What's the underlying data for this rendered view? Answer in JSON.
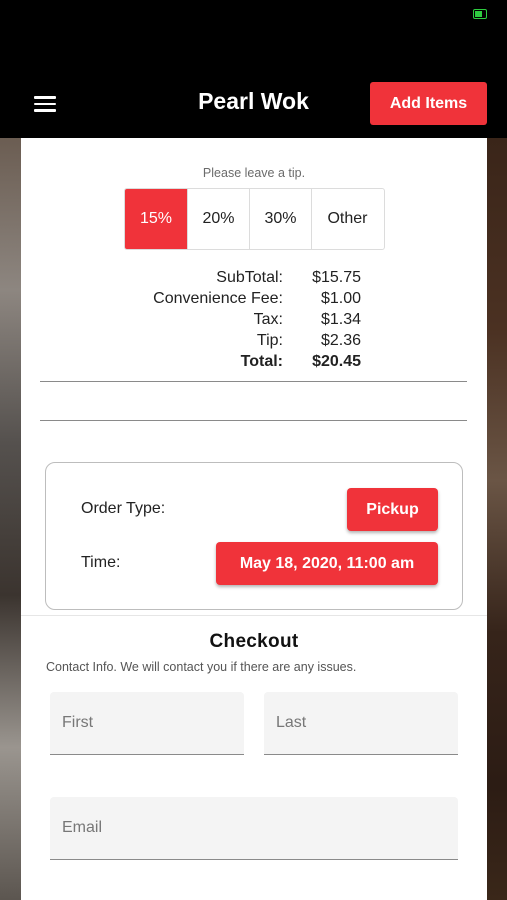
{
  "app": {
    "title": "Pearl Wok",
    "add_items_label": "Add Items"
  },
  "tip": {
    "prompt": "Please leave a tip.",
    "options": [
      "15%",
      "20%",
      "30%",
      "Other"
    ],
    "selected": "15%"
  },
  "summary": {
    "rows": [
      {
        "label": "SubTotal:",
        "value": "$15.75"
      },
      {
        "label": "Convenience Fee:",
        "value": "$1.00"
      },
      {
        "label": "Tax:",
        "value": "$1.34"
      },
      {
        "label": "Tip:",
        "value": "$2.36"
      },
      {
        "label": "Total:",
        "value": "$20.45"
      }
    ]
  },
  "order": {
    "type_label": "Order Type:",
    "type_value": "Pickup",
    "time_label": "Time:",
    "time_value": "May 18, 2020, 11:00 am"
  },
  "checkout": {
    "title": "Checkout",
    "contact_info": "Contact Info. We will contact you if there are any issues.",
    "first_placeholder": "First",
    "last_placeholder": "Last",
    "email_placeholder": "Email"
  },
  "colors": {
    "accent": "#f0333a",
    "status_battery": "#2ecc40"
  },
  "icons": {
    "menu": "menu-icon",
    "battery": "battery-icon"
  }
}
